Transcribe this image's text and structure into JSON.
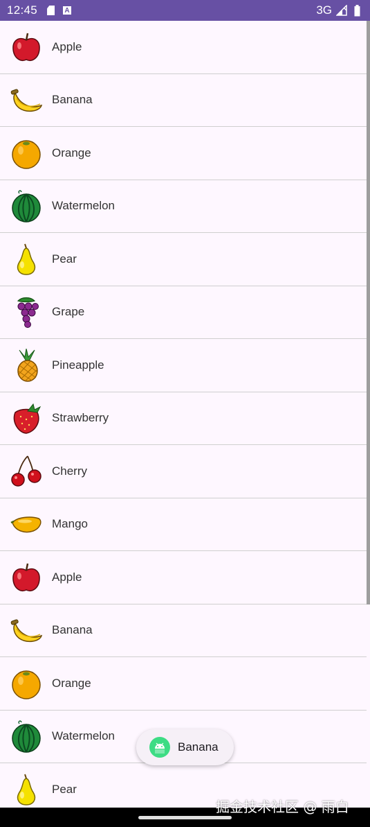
{
  "status_bar": {
    "time": "12:45",
    "network": "3G",
    "sd_icon": "sd-card-icon",
    "a_icon": "accessibility-a-icon",
    "signal_icon": "signal-icon",
    "battery_icon": "battery-icon"
  },
  "list": {
    "items": [
      {
        "label": "Apple",
        "icon": "apple-icon"
      },
      {
        "label": "Banana",
        "icon": "banana-icon"
      },
      {
        "label": "Orange",
        "icon": "orange-icon"
      },
      {
        "label": "Watermelon",
        "icon": "watermelon-icon"
      },
      {
        "label": "Pear",
        "icon": "pear-icon"
      },
      {
        "label": "Grape",
        "icon": "grape-icon"
      },
      {
        "label": "Pineapple",
        "icon": "pineapple-icon"
      },
      {
        "label": "Strawberry",
        "icon": "strawberry-icon"
      },
      {
        "label": "Cherry",
        "icon": "cherry-icon"
      },
      {
        "label": "Mango",
        "icon": "mango-icon"
      },
      {
        "label": "Apple",
        "icon": "apple-icon"
      },
      {
        "label": "Banana",
        "icon": "banana-icon"
      },
      {
        "label": "Orange",
        "icon": "orange-icon"
      },
      {
        "label": "Watermelon",
        "icon": "watermelon-icon"
      },
      {
        "label": "Pear",
        "icon": "pear-icon"
      }
    ]
  },
  "toast": {
    "text": "Banana",
    "icon": "android-icon"
  },
  "watermark": "掘金技术社区 @ 雨白",
  "colors": {
    "status_bar": "#6750a4",
    "background": "#fef7ff",
    "divider": "#cfcfcf"
  }
}
